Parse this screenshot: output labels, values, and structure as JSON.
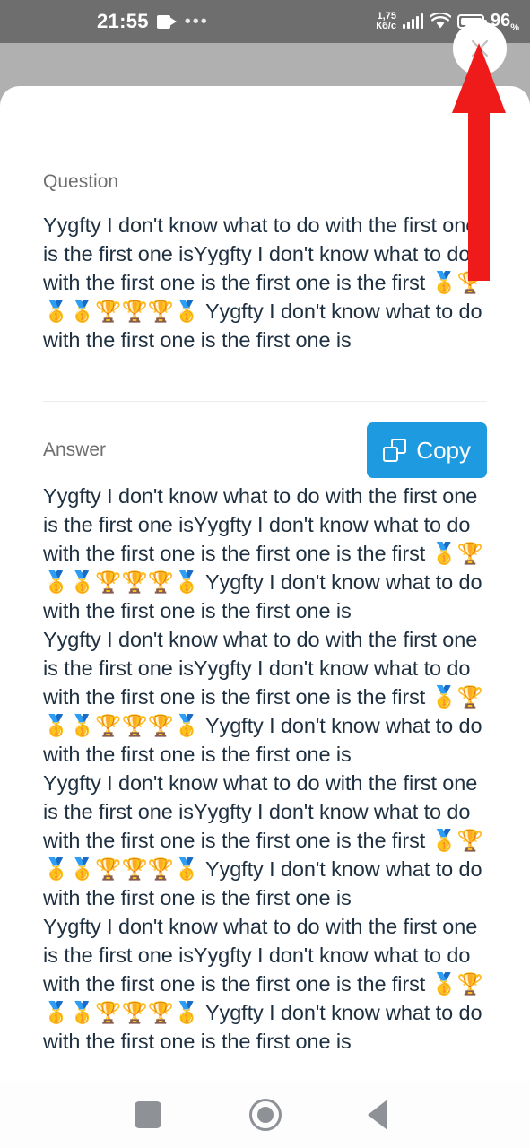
{
  "status_bar": {
    "time": "21:55",
    "recording_icon": "video-camera-icon",
    "overflow_dots": "•••",
    "network_speed": "1,75\nКб/с",
    "network_speed_value": "1,75",
    "network_speed_unit": "Кб/с",
    "signal_icon": "cellular-signal-icon",
    "wifi_icon": "wifi-icon",
    "battery_icon": "battery-icon",
    "battery_percent": "96",
    "battery_percent_unit": "%",
    "background_color": "#6e6e6e"
  },
  "close_button": {
    "icon": "close-x-icon",
    "label": ""
  },
  "annotation": {
    "type": "red-arrow-up",
    "color": "#ef1b1b",
    "points_to": "close-button"
  },
  "sheet": {
    "question": {
      "label": "Question",
      "text": "Yygfty I don't know what to do with the first one is the first one isYygfty I don't know what to do with the first one is the first one is the first 🥇🏆🥇🥇🏆🏆🏆🥇 Yygfty I don't know what to do with the first one is the first one is"
    },
    "answer": {
      "label": "Answer",
      "copy_label": "Copy",
      "copy_icon": "copy-icon",
      "text": "Yygfty I don't know what to do with the first one is the first one isYygfty I don't know what to do with the first one is the first one is the first 🥇🏆🥇🥇🏆🏆🏆🥇 Yygfty I don't know what to do with the first one is the first one is\nYygfty I don't know what to do with the first one is the first one isYygfty I don't know what to do with the first one is the first one is the first 🥇🏆🥇🥇🏆🏆🏆🥇 Yygfty I don't know what to do with the first one is the first one is\nYygfty I don't know what to do with the first one is the first one isYygfty I don't know what to do with the first one is the first one is the first 🥇🏆🥇🥇🏆🏆🏆🥇 Yygfty I don't know what to do with the first one is the first one is\nYygfty I don't know what to do with the first one is the first one isYygfty I don't know what to do with the first one is the first one is the first 🥇🏆🥇🥇🏆🏆🏆🥇 Yygfty I don't know what to do with the first one is the first one is"
    }
  },
  "nav_bar": {
    "recent_icon": "recent-apps-square-icon",
    "home_icon": "home-circle-icon",
    "back_icon": "back-triangle-icon"
  },
  "colors": {
    "accent": "#1e9ae0",
    "text": "#1f3040",
    "label": "#6f6f6f",
    "scrim": "#b0b0b0",
    "status_bar": "#6e6e6e",
    "annotation_red": "#ef1b1b"
  }
}
